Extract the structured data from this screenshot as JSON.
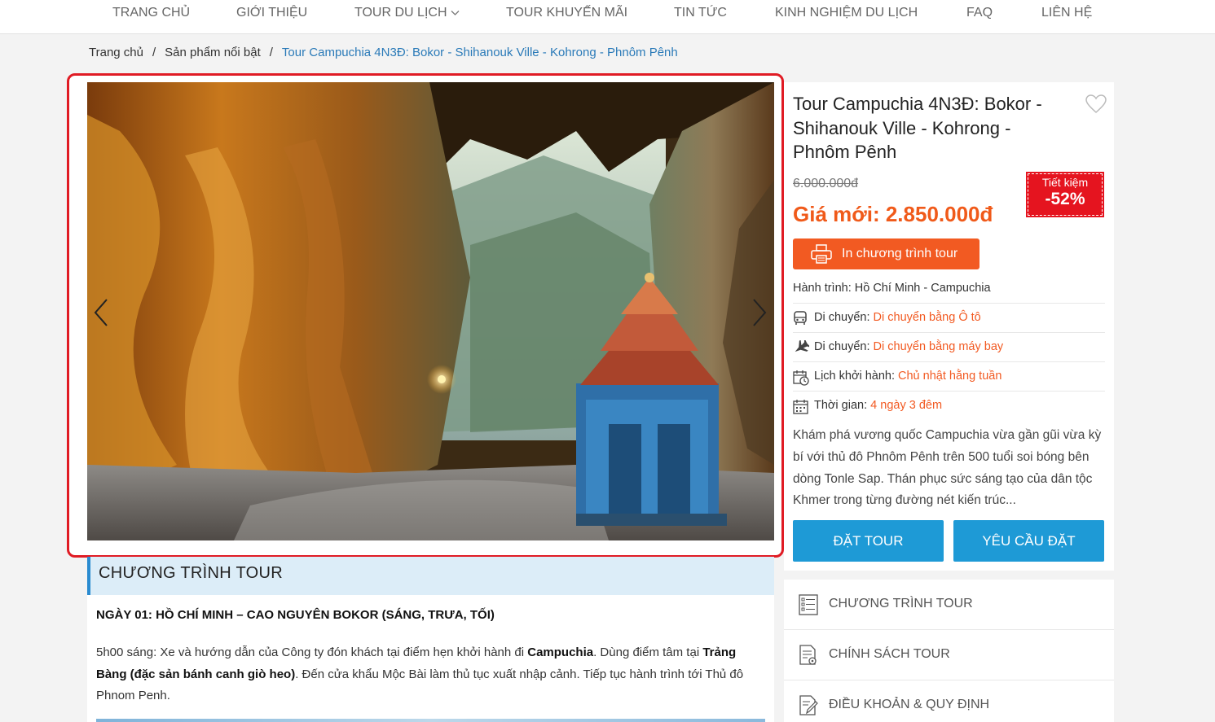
{
  "nav": {
    "items": [
      {
        "label": "TRANG CHỦ"
      },
      {
        "label": "GIỚI THIỆU"
      },
      {
        "label": "TOUR DU LỊCH"
      },
      {
        "label": "TOUR KHUYẾN MÃI"
      },
      {
        "label": "TIN TỨC"
      },
      {
        "label": "KINH NGHIỆM DU LỊCH"
      },
      {
        "label": "FAQ"
      },
      {
        "label": "LIÊN HỆ"
      }
    ]
  },
  "breadcrumb": {
    "home": "Trang chủ",
    "separator": "/",
    "category": "Sản phẩm nổi bật",
    "current": "Tour Campuchia 4N3Đ: Bokor - Shihanouk Ville - Kohrong - Phnôm Pênh"
  },
  "tour": {
    "title": "Tour Campuchia 4N3Đ: Bokor - Shihanouk Ville - Kohrong - Phnôm Pênh",
    "old_price": "6.000.000đ",
    "new_price": "Giá mới: 2.850.000đ",
    "save_label": "Tiết kiệm",
    "save_percent": "-52%",
    "print_label": "In chương trình tour",
    "itinerary": "Hành trình: Hồ Chí Minh - Campuchia",
    "attributes": [
      {
        "label": "Di chuyển: ",
        "value": "Di chuyển bằng Ô tô",
        "icon": "bus-icon"
      },
      {
        "label": "Di chuyển: ",
        "value": "Di chuyển bằng máy bay",
        "icon": "plane-icon"
      },
      {
        "label": "Lịch khởi hành: ",
        "value": "Chủ nhật hằng tuần",
        "icon": "calendar-clock-icon"
      },
      {
        "label": "Thời gian: ",
        "value": "4 ngày 3 đêm",
        "icon": "calendar-icon"
      }
    ],
    "description": "Khám phá vương quốc Campuchia vừa gần gũi vừa kỳ bí với thủ đô Phnôm Pênh trên 500 tuổi soi bóng bên dòng Tonle Sap. Thán phục sức sáng tạo của dân tộc Khmer trong từng đường nét kiến trúc...",
    "book_label": "ĐẶT TOUR",
    "request_label": "YÊU CẦU ĐẶT"
  },
  "program": {
    "heading": "CHƯƠNG TRÌNH TOUR",
    "day1_title": "NGÀY 01: HỒ CHÍ MINH –  CAO NGUYÊN BOKOR (SÁNG, TRƯA, TỐI)",
    "day1_p1": "5h00 sáng: Xe và hướng dẫn của Công ty đón khách tại điểm hẹn khởi hành đi ",
    "day1_b1": "Campuchia",
    "day1_p2": ". Dùng điểm tâm tại ",
    "day1_b2": "Trảng Bàng (đặc sản bánh canh giò heo)",
    "day1_p3": ". Đến cửa khẩu Mộc Bài làm thủ tục xuất nhập cảnh. Tiếp tục hành trình tới Thủ đô Phnom Penh."
  },
  "side_menu": {
    "items": [
      {
        "label": "CHƯƠNG TRÌNH TOUR"
      },
      {
        "label": "CHÍNH SÁCH TOUR"
      },
      {
        "label": "ĐIỀU KHOẢN & QUY ĐỊNH"
      }
    ]
  },
  "colors": {
    "accent_orange": "#f25a22",
    "price_orange": "#f05a1a",
    "badge_red": "#e5141f",
    "button_blue": "#1e9ad6",
    "link_blue": "#2a7ab8",
    "frame_red": "#e01b24"
  }
}
